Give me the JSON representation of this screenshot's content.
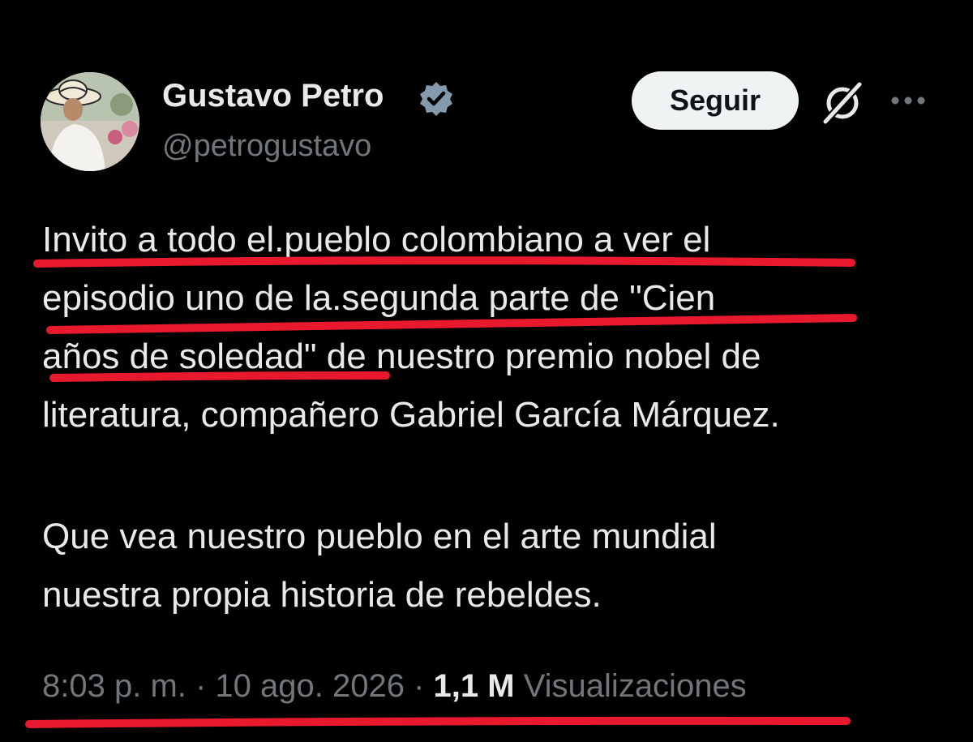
{
  "author": {
    "name": "Gustavo Petro",
    "handle": "@petrogustavo",
    "verified": true,
    "avatar_icon": "avatar-photo"
  },
  "actions": {
    "follow_label": "Seguir",
    "grok_icon": "grok-icon",
    "more_icon": "more-dots-icon"
  },
  "tweet": {
    "paragraph1_lines": [
      "Invito a todo el.pueblo colombiano a ver el",
      "episodio uno de la.segunda parte de \"Cien",
      "años de soledad\" de nuestro premio nobel de",
      "literatura, compañero Gabriel García Márquez."
    ],
    "paragraph2_lines": [
      "Que vea nuestro pueblo en el arte mundial",
      "nuestra propia historia de rebeldes."
    ]
  },
  "meta": {
    "time": "8:03 p. m.",
    "separator": " · ",
    "date": "10 ago. 2026",
    "views_count": "1,1 M",
    "views_label": "Visualizaciones"
  },
  "colors": {
    "background": "#000000",
    "text": "#e7e9ea",
    "muted": "#71767b",
    "follow_button_bg": "#eff3f4",
    "underline_red": "#e8192c",
    "verified_fill": "#829aab"
  }
}
